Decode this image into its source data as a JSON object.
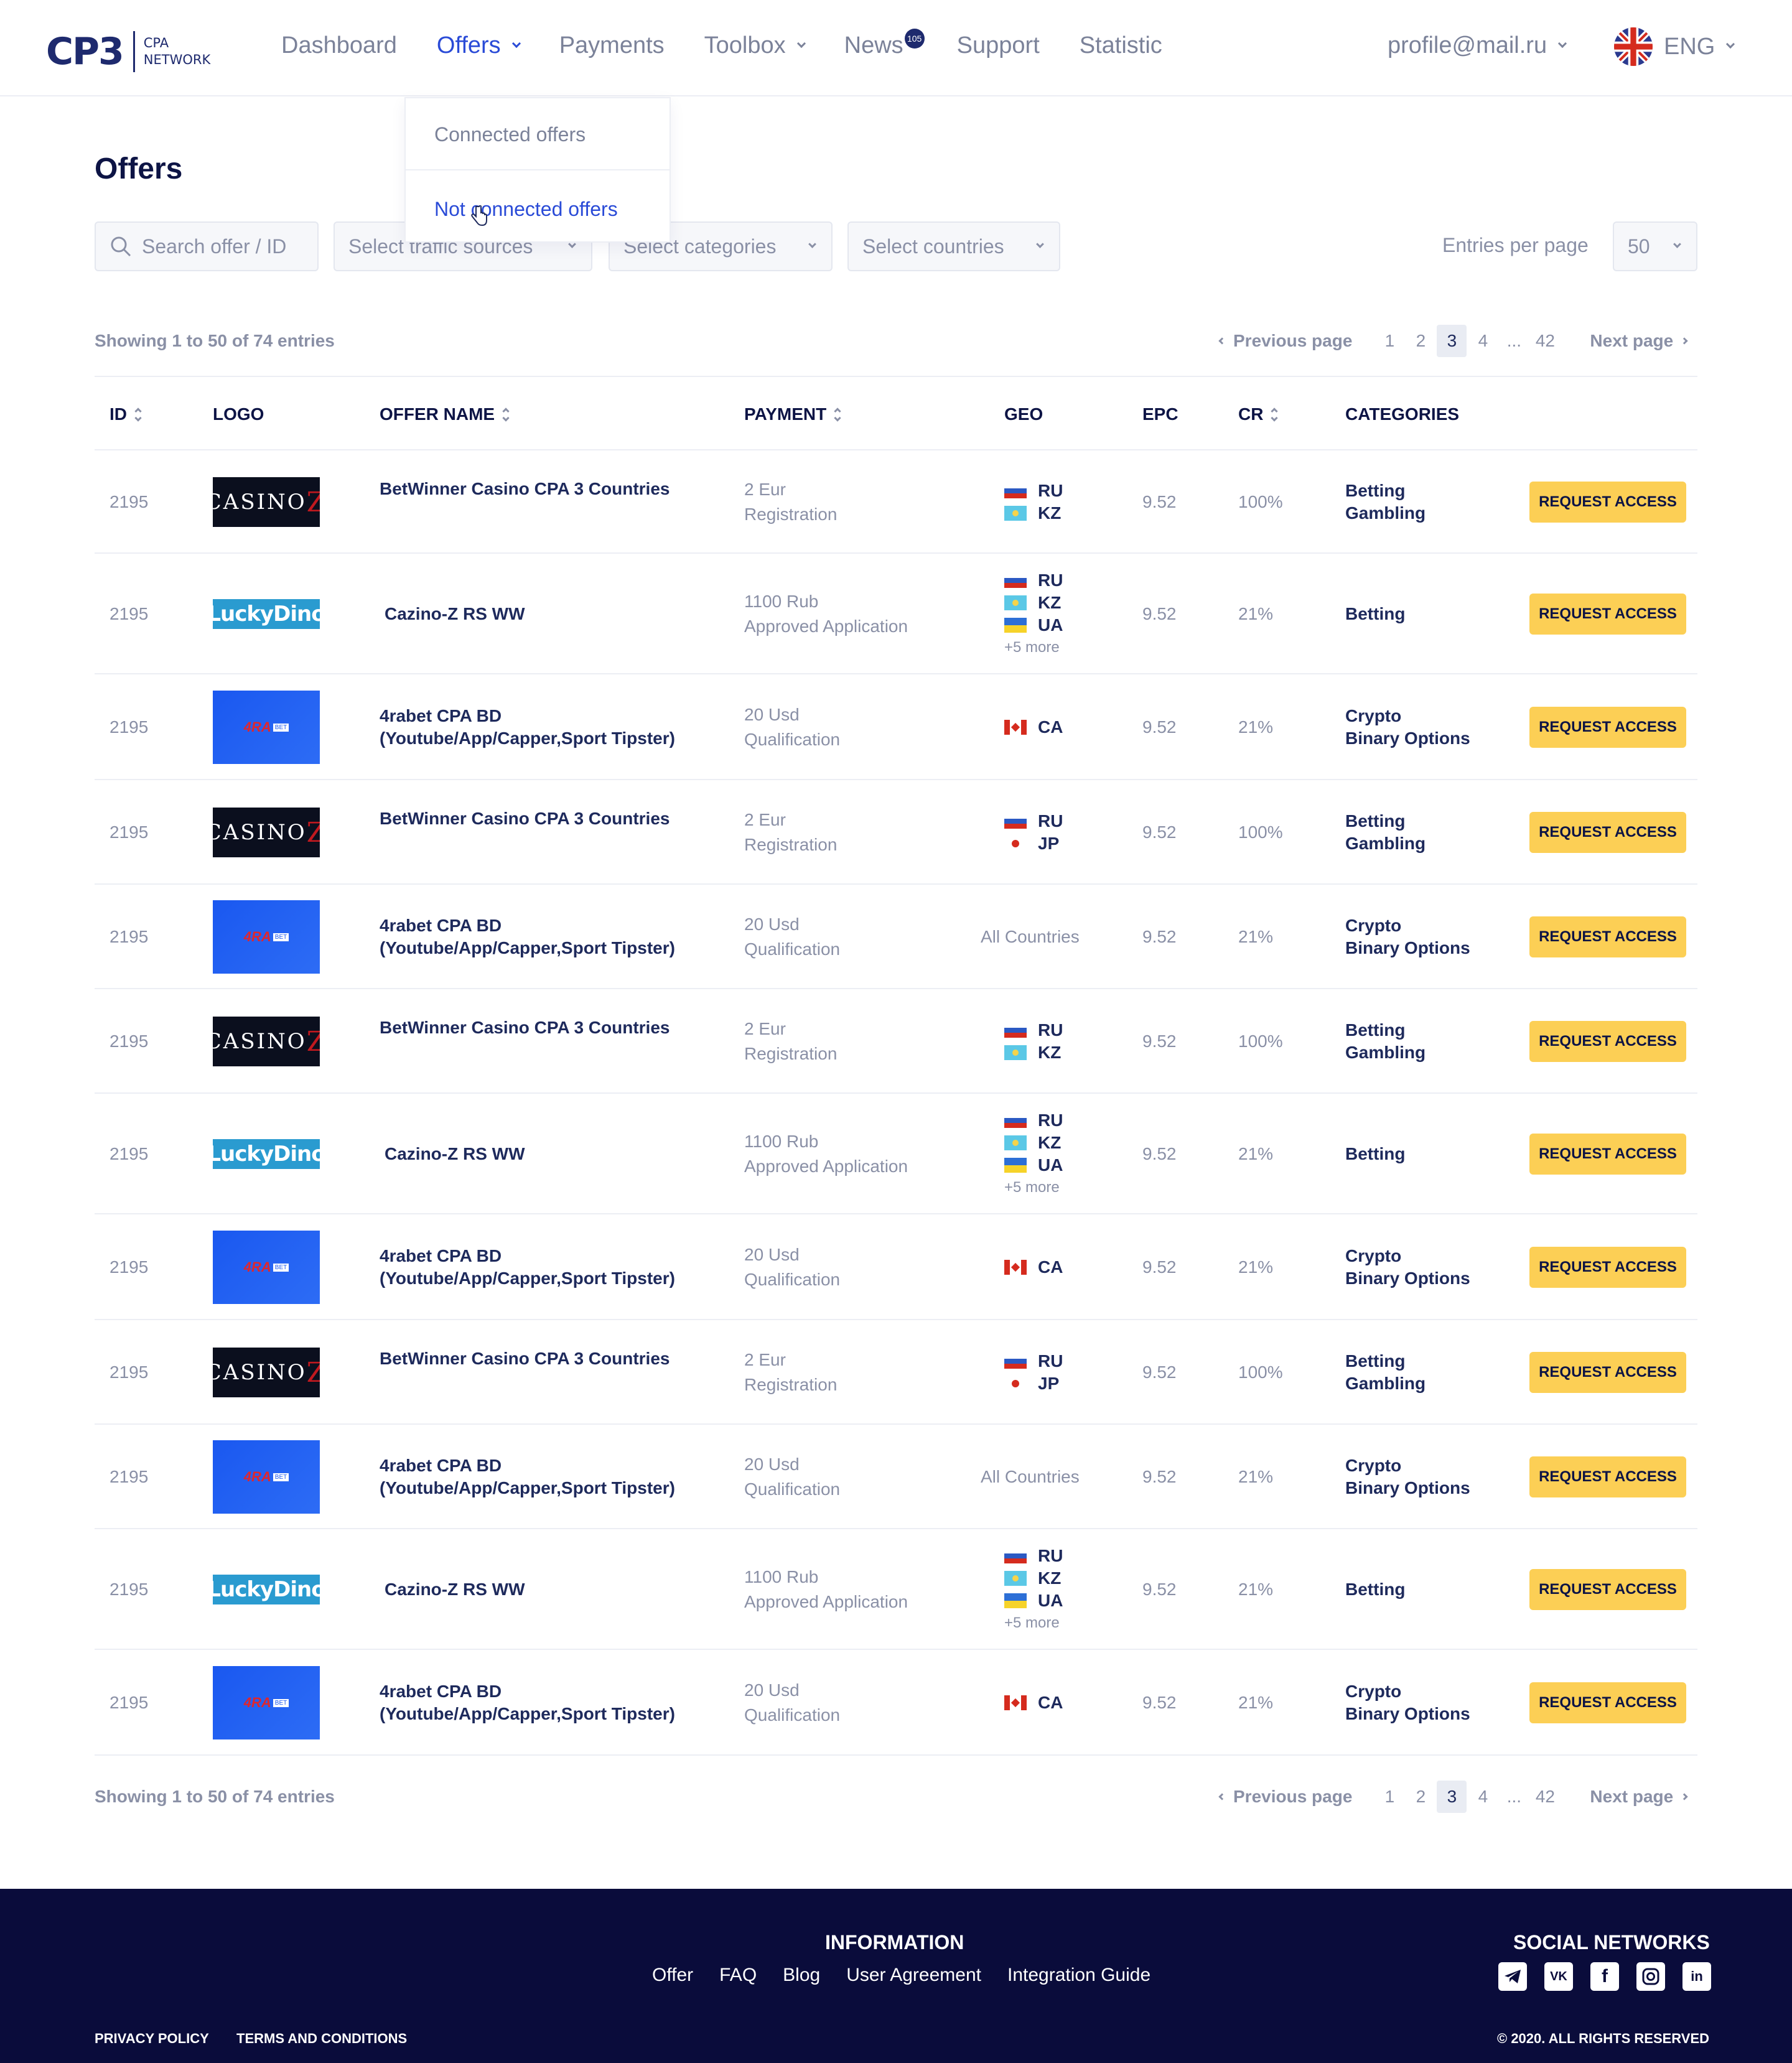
{
  "brand": {
    "mark": "CP3",
    "sub_line1": "CPA",
    "sub_line2": "NETWORK"
  },
  "nav": [
    {
      "label": "Dashboard"
    },
    {
      "label": "Offers"
    },
    {
      "label": "Payments"
    },
    {
      "label": "Toolbox"
    },
    {
      "label": "News",
      "badge": "105"
    },
    {
      "label": "Support"
    },
    {
      "label": "Statistic"
    }
  ],
  "profile": "profile@mail.ru",
  "language": "ENG",
  "offers_menu": {
    "connected": "Connected offers",
    "not_connected": "Not connected offers"
  },
  "page_title": "Offers",
  "filters": {
    "search_placeholder": "Search offer / ID",
    "traffic": "Select traffic sources",
    "categories": "Select categories",
    "countries": "Select countries",
    "entries_label": "Entries per page",
    "entries_value": "50"
  },
  "showing": "Showing 1 to 50 of 74 entries",
  "pagination": {
    "prev": "Previous page",
    "next": "Next page",
    "pages": [
      "1",
      "2",
      "3",
      "4",
      "...",
      "42"
    ],
    "current": "3"
  },
  "columns": {
    "id": "ID",
    "logo": "LOGO",
    "name": "OFFER NAME",
    "payment": "PAYMENT",
    "geo": "GEO",
    "epc": "EPC",
    "cr": "CR",
    "categories": "CATEGORIES"
  },
  "button_label": "REQUEST ACCESS",
  "logo_texts": {
    "casino": "CASINO",
    "casino_z": "Z",
    "lucky": "LuckyDino",
    "ra": "4RA",
    "bet": "BET"
  },
  "rows": [
    {
      "id": "2195",
      "logo": "casino",
      "name": [
        "BetWinner Casino CPA 3 Countries"
      ],
      "pay": [
        "2 Eur",
        "Registration"
      ],
      "geo": [
        [
          "ru",
          "RU"
        ],
        [
          "kz",
          "KZ"
        ]
      ],
      "more": "",
      "epc": "9.52",
      "cr": "100%",
      "cats": [
        "Betting",
        "Gambling"
      ]
    },
    {
      "id": "2195",
      "logo": "lucky",
      "name": [
        "Cazino-Z RS WW"
      ],
      "pay": [
        "1100 Rub",
        "Approved Application"
      ],
      "geo": [
        [
          "ru",
          "RU"
        ],
        [
          "kz",
          "KZ"
        ],
        [
          "ua",
          "UA"
        ]
      ],
      "more": "+5 more",
      "epc": "9.52",
      "cr": "21%",
      "cats": [
        "Betting"
      ]
    },
    {
      "id": "2195",
      "logo": "ra",
      "name": [
        "4rabet CPA BD",
        "(Youtube/App/Capper,Sport Tipster)"
      ],
      "pay": [
        "20 Usd",
        "Qualification"
      ],
      "geo": [
        [
          "ca",
          "CA"
        ]
      ],
      "more": "",
      "epc": "9.52",
      "cr": "21%",
      "cats": [
        "Crypto",
        "Binary Options"
      ]
    },
    {
      "id": "2195",
      "logo": "casino",
      "name": [
        "BetWinner Casino CPA 3 Countries"
      ],
      "pay": [
        "2 Eur",
        "Registration"
      ],
      "geo": [
        [
          "ru",
          "RU"
        ],
        [
          "jp",
          "JP"
        ]
      ],
      "more": "",
      "epc": "9.52",
      "cr": "100%",
      "cats": [
        "Betting",
        "Gambling"
      ]
    },
    {
      "id": "2195",
      "logo": "ra",
      "name": [
        "4rabet CPA BD",
        "(Youtube/App/Capper,Sport Tipster)"
      ],
      "pay": [
        "20 Usd",
        "Qualification"
      ],
      "geo": [],
      "all": "All Countries",
      "more": "",
      "epc": "9.52",
      "cr": "21%",
      "cats": [
        "Crypto",
        "Binary Options"
      ]
    },
    {
      "id": "2195",
      "logo": "casino",
      "name": [
        "BetWinner Casino CPA 3 Countries"
      ],
      "pay": [
        "2 Eur",
        "Registration"
      ],
      "geo": [
        [
          "ru",
          "RU"
        ],
        [
          "kz",
          "KZ"
        ]
      ],
      "more": "",
      "epc": "9.52",
      "cr": "100%",
      "cats": [
        "Betting",
        "Gambling"
      ]
    },
    {
      "id": "2195",
      "logo": "lucky",
      "name": [
        "Cazino-Z RS WW"
      ],
      "pay": [
        "1100 Rub",
        "Approved Application"
      ],
      "geo": [
        [
          "ru",
          "RU"
        ],
        [
          "kz",
          "KZ"
        ],
        [
          "ua",
          "UA"
        ]
      ],
      "more": "+5 more",
      "epc": "9.52",
      "cr": "21%",
      "cats": [
        "Betting"
      ]
    },
    {
      "id": "2195",
      "logo": "ra",
      "name": [
        "4rabet CPA BD",
        "(Youtube/App/Capper,Sport Tipster)"
      ],
      "pay": [
        "20 Usd",
        "Qualification"
      ],
      "geo": [
        [
          "ca",
          "CA"
        ]
      ],
      "more": "",
      "epc": "9.52",
      "cr": "21%",
      "cats": [
        "Crypto",
        "Binary Options"
      ]
    },
    {
      "id": "2195",
      "logo": "casino",
      "name": [
        "BetWinner Casino CPA 3 Countries"
      ],
      "pay": [
        "2 Eur",
        "Registration"
      ],
      "geo": [
        [
          "ru",
          "RU"
        ],
        [
          "jp",
          "JP"
        ]
      ],
      "more": "",
      "epc": "9.52",
      "cr": "100%",
      "cats": [
        "Betting",
        "Gambling"
      ]
    },
    {
      "id": "2195",
      "logo": "ra",
      "name": [
        "4rabet CPA BD",
        "(Youtube/App/Capper,Sport Tipster)"
      ],
      "pay": [
        "20 Usd",
        "Qualification"
      ],
      "geo": [],
      "all": "All Countries",
      "more": "",
      "epc": "9.52",
      "cr": "21%",
      "cats": [
        "Crypto",
        "Binary Options"
      ]
    },
    {
      "id": "2195",
      "logo": "lucky",
      "name": [
        "Cazino-Z RS WW"
      ],
      "pay": [
        "1100 Rub",
        "Approved Application"
      ],
      "geo": [
        [
          "ru",
          "RU"
        ],
        [
          "kz",
          "KZ"
        ],
        [
          "ua",
          "UA"
        ]
      ],
      "more": "+5 more",
      "epc": "9.52",
      "cr": "21%",
      "cats": [
        "Betting"
      ]
    },
    {
      "id": "2195",
      "logo": "ra",
      "name": [
        "4rabet CPA BD",
        "(Youtube/App/Capper,Sport Tipster)"
      ],
      "pay": [
        "20 Usd",
        "Qualification"
      ],
      "geo": [
        [
          "ca",
          "CA"
        ]
      ],
      "more": "",
      "epc": "9.52",
      "cr": "21%",
      "cats": [
        "Crypto",
        "Binary Options"
      ]
    }
  ],
  "footer": {
    "info_title": "INFORMATION",
    "links": [
      "Offer",
      "FAQ",
      "Blog",
      "User Agreement",
      "Integration Guide"
    ],
    "social_title": "SOCIAL NETWORKS",
    "socials": [
      "telegram-icon",
      "vk-icon",
      "facebook-icon",
      "instagram-icon",
      "linkedin-icon"
    ],
    "privacy": "PRIVACY POLICY",
    "terms": "TERMS AND CONDITIONS",
    "copyright": "© 2020. ALL RIGHTS RESERVED"
  },
  "colors": {
    "accent": "#2a4bd7",
    "button": "#fccf55",
    "footer_bg": "#0a0c3b",
    "text": "#1e2a5c"
  }
}
